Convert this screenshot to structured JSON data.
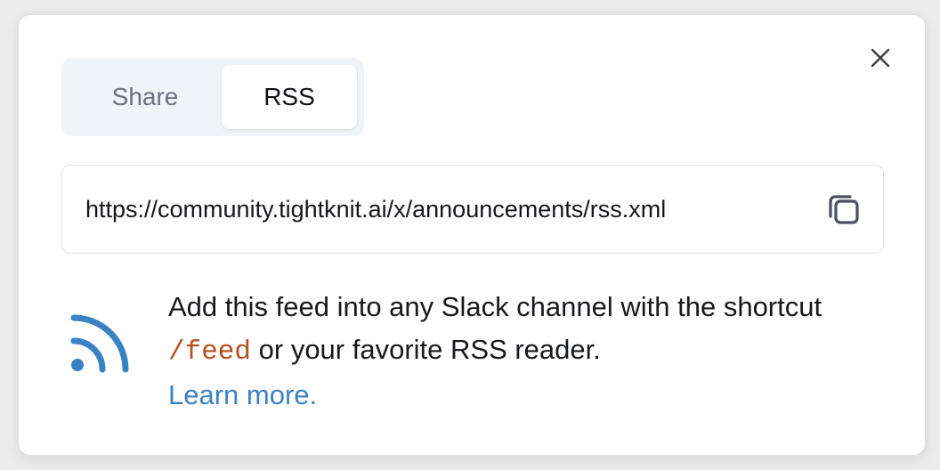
{
  "tabs": [
    {
      "label": "Share",
      "selected": false
    },
    {
      "label": "RSS",
      "selected": true
    }
  ],
  "feed": {
    "url": "https://community.tightknit.ai/x/announcements/rss.xml"
  },
  "info": {
    "line_part1": "Add this feed into any Slack channel with the shortcut",
    "command": "/feed",
    "line_part2": "or your favorite RSS reader.",
    "learn_more": "Learn more."
  },
  "icons": {
    "close": "close-icon",
    "copy": "copy-icon",
    "rss": "rss-icon"
  },
  "colors": {
    "accent": "#3b82c4",
    "command": "#b4501d",
    "tab_bg": "#f0f3f7"
  }
}
